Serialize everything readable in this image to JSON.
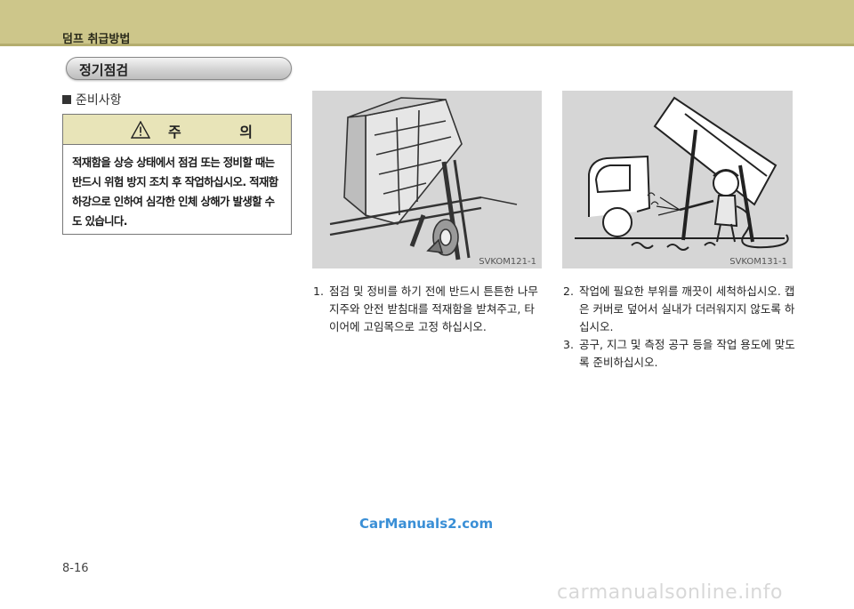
{
  "header": {
    "chapter_title": "덤프 취급방법"
  },
  "section": {
    "title": "정기점검"
  },
  "subheading": {
    "text": "준비사항"
  },
  "caution": {
    "title": "주 의",
    "body": "적재함을 상승 상태에서 점검 또는 정비할 때는 반드시 위험 방지 조치 후 작업하십시오. 적재함 하강으로 인하여 심각한 인체 상해가 발생할 수도 있습니다."
  },
  "figures": [
    {
      "code": "SVKOM121-1",
      "icon": "raised-dump-body-propped-illustration"
    },
    {
      "code": "SVKOM131-1",
      "icon": "worker-washing-dump-truck-illustration"
    }
  ],
  "steps_left": [
    {
      "num": "1.",
      "text": "점검 및 정비를 하기 전에 반드시 튼튼한 나무지주와 안전 받침대를 적재함을 받쳐주고, 타이어에 고임목으로 고정 하십시오."
    }
  ],
  "steps_right": [
    {
      "num": "2.",
      "text": "작업에 필요한 부위를 깨끗이 세척하십시오. 캡은 커버로 덮어서 실내가 더러워지지 않도록 하십시오."
    },
    {
      "num": "3.",
      "text": "공구, 지그 및 측정 공구 등을 작업 용도에 맞도록 준비하십시오."
    }
  ],
  "watermark": "CarManuals2.com",
  "page_number": "8-16",
  "footer_site": "carmanualsonline.info"
}
